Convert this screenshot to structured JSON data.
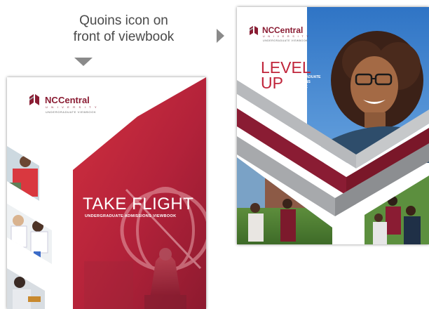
{
  "caption": {
    "line1": "Quoins icon on",
    "line2": "front of viewbook"
  },
  "arrows": {
    "down_icon": "triangle-down",
    "right_icon": "triangle-right"
  },
  "colors": {
    "maroon": "#8a1c33",
    "crimson": "#c0253b",
    "gray_band": "#a7a9ac",
    "text_gray": "#4a4a4a",
    "arrow_gray": "#8a8a8a"
  },
  "left_book": {
    "logo_nc": "NC",
    "logo_central": "Central",
    "logo_university": "UNIVERSITY",
    "logo_tagline": "UNDERGRADUATE VIEWBOOK",
    "title": "TAKE FLIGHT",
    "subtitle": "UNDERGRADUATE ADMISSIONS VIEWBOOK"
  },
  "right_book": {
    "logo_nc": "NC",
    "logo_central": "Central",
    "logo_university": "UNIVERSITY",
    "logo_tagline": "UNDERGRADUATE VIEWBOOK",
    "title_line1": "LEVEL",
    "title_line2": "UP",
    "subtitle_line1": "UNDERGRADUATE",
    "subtitle_line2": "ADMISSIONS",
    "subtitle_line3": "VIEWBOOK"
  }
}
